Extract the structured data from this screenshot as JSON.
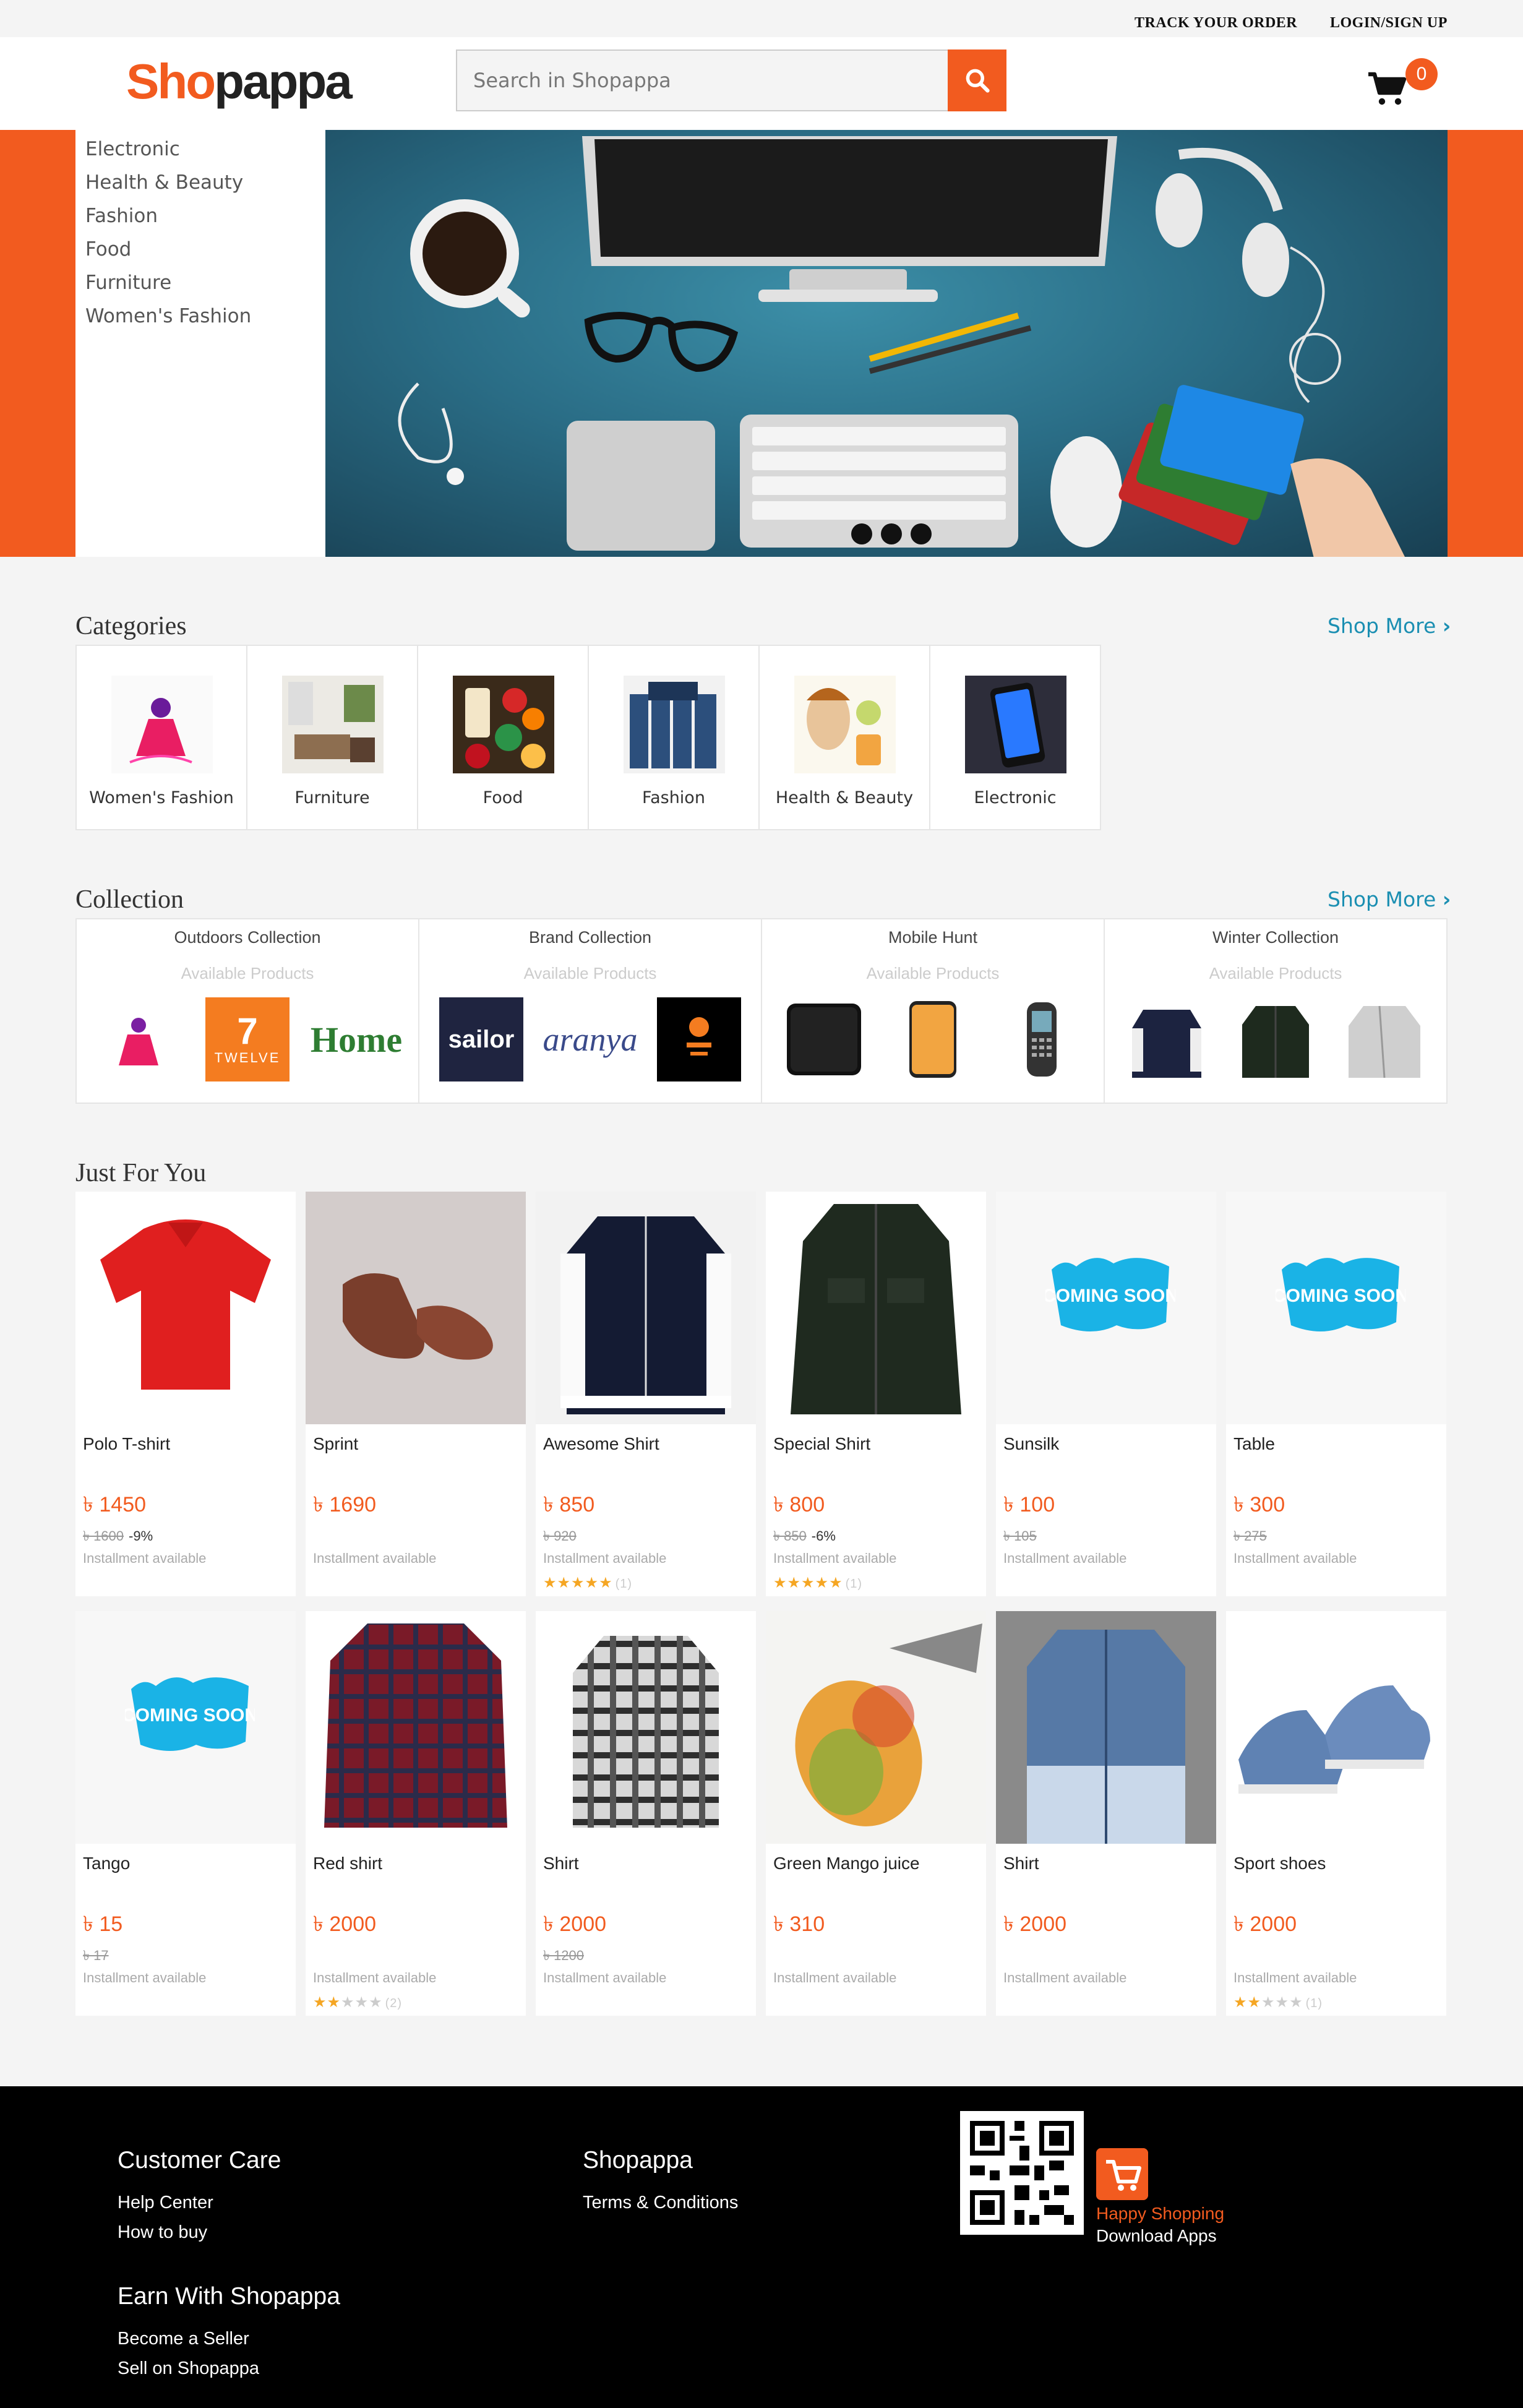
{
  "topbar": {
    "track": "TRACK YOUR ORDER",
    "login": "LOGIN/SIGN UP"
  },
  "header": {
    "logo_part1": "Sho",
    "logo_part2": "pappa",
    "search_placeholder": "Search in Shopappa",
    "cart_count": "0"
  },
  "side_categories": [
    "Electronic",
    "Health & Beauty",
    "Fashion",
    "Food",
    "Furniture",
    "Women's Fashion"
  ],
  "categories": {
    "title": "Categories",
    "shop_more": "Shop More",
    "items": [
      "Women's Fashion",
      "Furniture",
      "Food",
      "Fashion",
      "Health & Beauty",
      "Electronic"
    ]
  },
  "collection": {
    "title": "Collection",
    "shop_more": "Shop More",
    "subtitle": "Available Products",
    "items": [
      {
        "name": "Outdoors Collection",
        "thumbs": [
          "",
          "TWELVE",
          "Home"
        ]
      },
      {
        "name": "Brand Collection",
        "thumbs": [
          "sailor",
          "aranya",
          ""
        ]
      },
      {
        "name": "Mobile Hunt",
        "thumbs": [
          "",
          "",
          ""
        ]
      },
      {
        "name": "Winter Collection",
        "thumbs": [
          "",
          "",
          ""
        ]
      }
    ]
  },
  "just_for_you": {
    "title": "Just For You",
    "installment": "Installment available",
    "coming_soon": "COMING SOON",
    "products": [
      {
        "name": "Polo T-shirt",
        "price": "৳ 1450",
        "old": "৳ 1600",
        "discount": "-9%",
        "rating": 0,
        "reviews": ""
      },
      {
        "name": "Sprint",
        "price": "৳ 1690",
        "old": "",
        "discount": "",
        "rating": 0,
        "reviews": ""
      },
      {
        "name": "Awesome Shirt",
        "price": "৳ 850",
        "old": "৳ 920",
        "discount": "",
        "rating": 5,
        "reviews": "(1)"
      },
      {
        "name": "Special Shirt",
        "price": "৳ 800",
        "old": "৳ 850",
        "discount": "-6%",
        "rating": 5,
        "reviews": "(1)"
      },
      {
        "name": "Sunsilk",
        "price": "৳ 100",
        "old": "৳ 105",
        "discount": "",
        "rating": 0,
        "reviews": ""
      },
      {
        "name": "Table",
        "price": "৳ 300",
        "old": "৳ 275",
        "discount": "",
        "rating": 0,
        "reviews": ""
      },
      {
        "name": "Tango",
        "price": "৳ 15",
        "old": "৳ 17",
        "discount": "",
        "rating": 0,
        "reviews": ""
      },
      {
        "name": "Red shirt",
        "price": "৳ 2000",
        "old": "",
        "discount": "",
        "rating": 2,
        "reviews": "(2)"
      },
      {
        "name": "Shirt",
        "price": "৳ 2000",
        "old": "৳ 1200",
        "discount": "",
        "rating": 0,
        "reviews": ""
      },
      {
        "name": "Green Mango juice",
        "price": "৳ 310",
        "old": "",
        "discount": "",
        "rating": 0,
        "reviews": ""
      },
      {
        "name": "Shirt",
        "price": "৳ 2000",
        "old": "",
        "discount": "",
        "rating": 0,
        "reviews": ""
      },
      {
        "name": "Sport shoes",
        "price": "৳ 2000",
        "old": "",
        "discount": "",
        "rating": 2,
        "reviews": "(1)"
      }
    ]
  },
  "footer": {
    "customer_care": "Customer Care",
    "help_center": "Help Center",
    "how_to_buy": "How to buy",
    "shopappa": "Shopappa",
    "terms": "Terms & Conditions",
    "earn": "Earn With Shopappa",
    "become_seller": "Become a Seller",
    "sell_on": "Sell on Shopappa",
    "happy": "Happy Shopping",
    "download": "Download Apps"
  },
  "colors": {
    "accent": "#f25b1f",
    "link": "#1b8fb2",
    "footer_bg": "#000000"
  }
}
